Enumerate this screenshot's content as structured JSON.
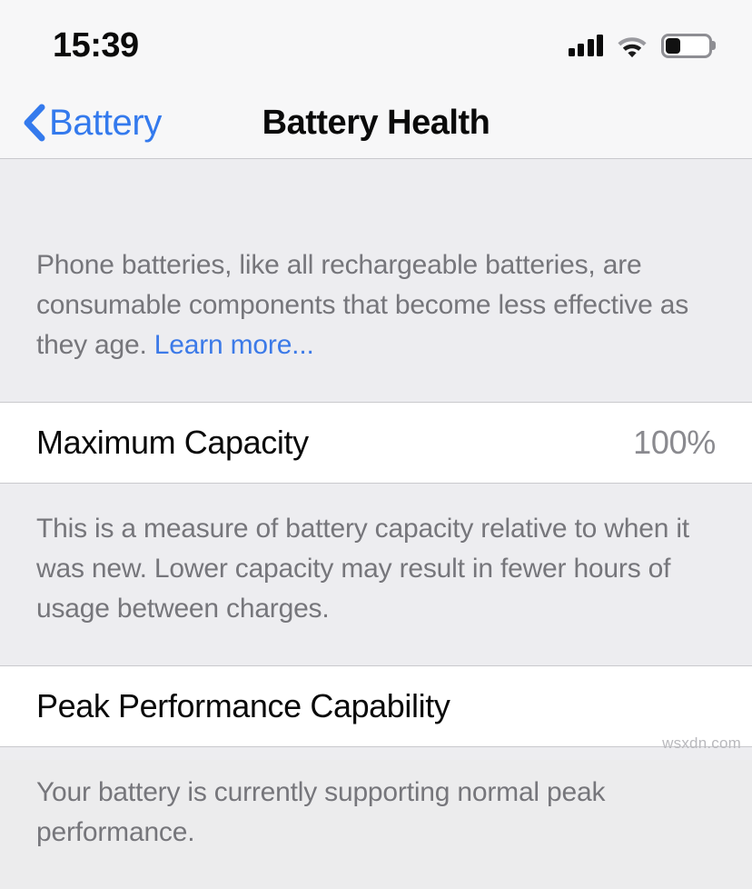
{
  "status_bar": {
    "time": "15:39",
    "signal_bars_total": 4,
    "signal_bars_filled": 4,
    "wifi_icon": "wifi-icon",
    "battery_icon": "battery-icon",
    "battery_level_percent": 32
  },
  "nav": {
    "back_label": "Battery",
    "back_icon": "chevron-left-icon",
    "title": "Battery Health"
  },
  "sections": {
    "intro_note": {
      "text_before_link": "Phone batteries, like all rechargeable batteries, are consumable components that become less effective as they age. ",
      "link_text": "Learn more..."
    },
    "maximum_capacity": {
      "title": "Maximum Capacity",
      "value": "100%",
      "note": "This is a measure of battery capacity relative to when it was new. Lower capacity may result in fewer hours of usage between charges."
    },
    "peak_performance": {
      "title": "Peak Performance Capability",
      "note": "Your battery is currently supporting normal peak performance."
    }
  },
  "watermark": "wsxdn.com",
  "colors": {
    "accent_blue": "#347aed",
    "link_blue": "#3c7ae8",
    "group_background": "#ededf0",
    "cell_background": "#ffffff",
    "secondary_text": "#76767b"
  }
}
